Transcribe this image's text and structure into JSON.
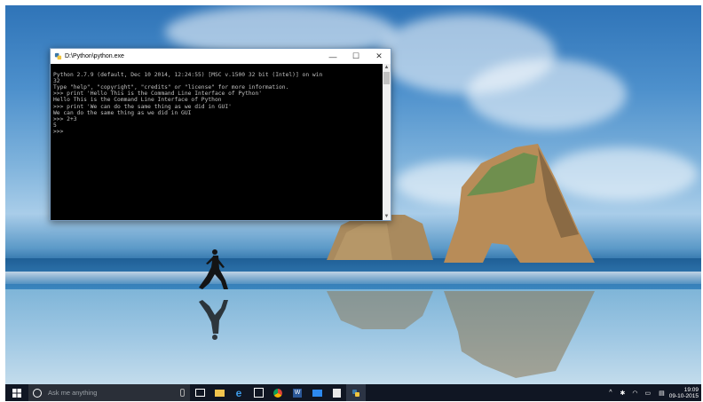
{
  "window": {
    "title": "D:\\Python\\python.exe",
    "minimize_label": "—",
    "maximize_label": "☐",
    "close_label": "✕",
    "console_lines": [
      "Python 2.7.9 (default, Dec 10 2014, 12:24:55) [MSC v.1500 32 bit (Intel)] on win",
      "32",
      "Type \"help\", \"copyright\", \"credits\" or \"license\" for more information.",
      ">>> print 'Hello This is the Command Line Interface of Python'",
      "Hello This is the Command Line Interface of Python",
      ">>> print 'We can do the same thing as we did in GUI'",
      "We can do the same thing as we did in GUI",
      ">>> 2+3",
      "5",
      ">>>"
    ]
  },
  "taskbar": {
    "search_placeholder": "Ask me anything",
    "pinned_icons": [
      "task-view-icon",
      "file-explorer-icon",
      "edge-icon",
      "store-icon",
      "chrome-icon",
      "word-icon",
      "photos-icon",
      "paint-icon",
      "python-icon"
    ],
    "clock_time": "19:09",
    "clock_date": "09-10-2015"
  },
  "colors": {
    "taskbar": "#101623",
    "console_bg": "#000000",
    "console_text": "#c0c0c0"
  }
}
